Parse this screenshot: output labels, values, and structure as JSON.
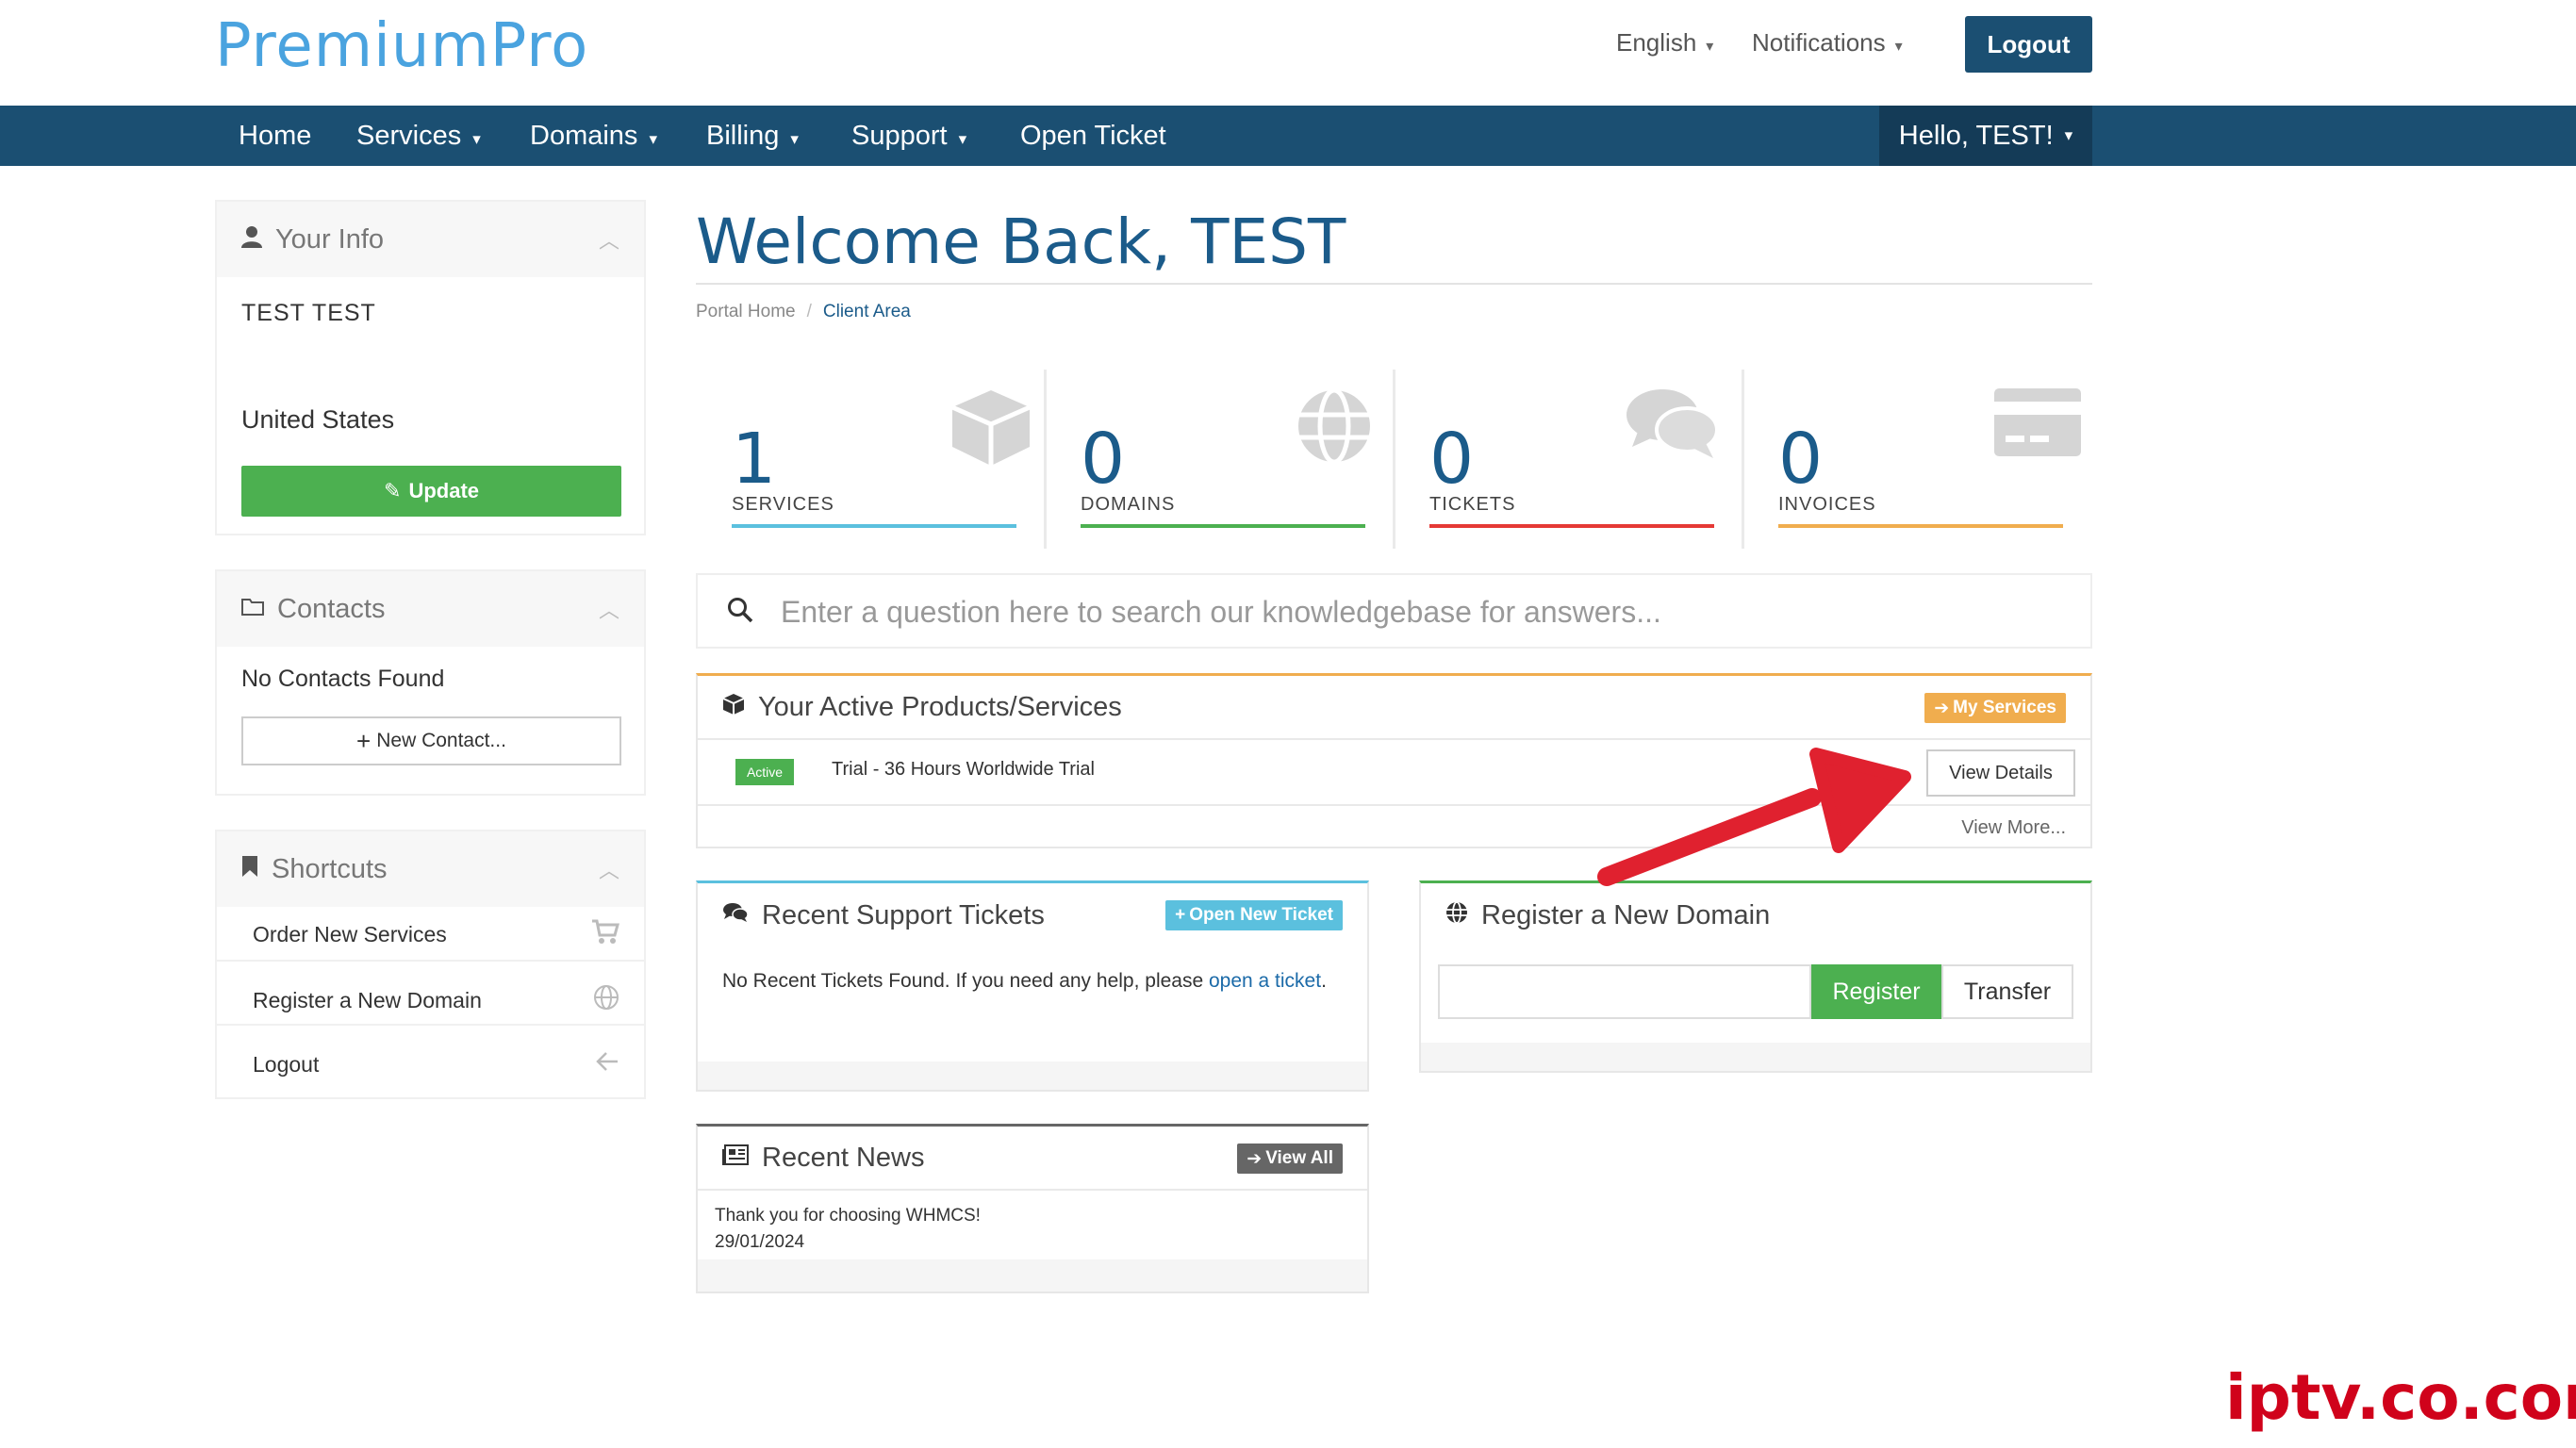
{
  "header": {
    "logo": "PremiumPro",
    "language": "English",
    "notifications": "Notifications",
    "logout": "Logout"
  },
  "nav": {
    "items": [
      "Home",
      "Services",
      "Domains",
      "Billing",
      "Support",
      "Open Ticket"
    ],
    "hello": "Hello, TEST!"
  },
  "sidebar": {
    "your_info": {
      "title": "Your Info",
      "name": "TEST TEST",
      "country": "United States",
      "update": "Update"
    },
    "contacts": {
      "title": "Contacts",
      "empty": "No Contacts Found",
      "new_contact": "New Contact..."
    },
    "shortcuts": {
      "title": "Shortcuts",
      "items": [
        {
          "label": "Order New Services",
          "icon": "cart-icon"
        },
        {
          "label": "Register a New Domain",
          "icon": "globe-icon"
        },
        {
          "label": "Logout",
          "icon": "arrow-left-icon"
        }
      ]
    }
  },
  "main": {
    "welcome": "Welcome Back, TEST",
    "breadcrumb": {
      "home": "Portal Home",
      "current": "Client Area"
    },
    "stats": [
      {
        "value": "1",
        "label": "SERVICES",
        "color": "#5bc0de",
        "icon": "box-icon"
      },
      {
        "value": "0",
        "label": "DOMAINS",
        "color": "#4cb050",
        "icon": "globe-icon"
      },
      {
        "value": "0",
        "label": "TICKETS",
        "color": "#e53935",
        "icon": "comments-icon"
      },
      {
        "value": "0",
        "label": "INVOICES",
        "color": "#f0ad4e",
        "icon": "credit-card-icon"
      }
    ],
    "search": {
      "placeholder": "Enter a question here to search our knowledgebase for answers..."
    },
    "products": {
      "title": "Your Active Products/Services",
      "my_services": "My Services",
      "status": "Active",
      "name": "Trial - 36 Hours Worldwide Trial",
      "view_details": "View Details",
      "view_more": "View More..."
    },
    "tickets": {
      "title": "Recent Support Tickets",
      "open_new": "Open New Ticket",
      "text": "No Recent Tickets Found. If you need any help, please ",
      "link": "open a ticket",
      "text_end": "."
    },
    "domain": {
      "title": "Register a New Domain",
      "register": "Register",
      "transfer": "Transfer"
    },
    "news": {
      "title": "Recent News",
      "view_all": "View All",
      "item_title": "Thank you for choosing WHMCS!",
      "item_date": "29/01/2024"
    }
  },
  "watermark": "iptv.co.com",
  "colors": {
    "brand": "#1b4f72",
    "accent_blue": "#5bc0de",
    "green": "#4cb050",
    "orange": "#f0ad4e",
    "red": "#e53935",
    "arrow": "#e0212f"
  }
}
